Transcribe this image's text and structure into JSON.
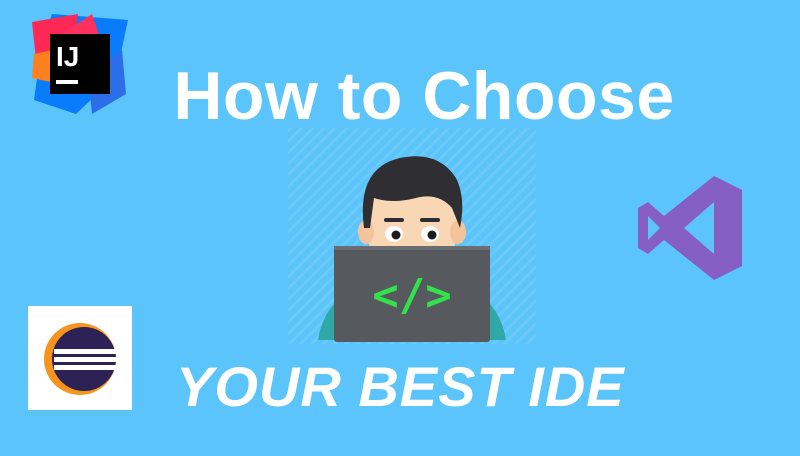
{
  "headline": "How to Choose",
  "subheadline": "YOUR BEST IDE",
  "logos": {
    "intellij_text": "IJ",
    "intellij_icon": "intellij-idea-logo-icon",
    "visual_studio_icon": "visual-studio-logo-icon",
    "eclipse_icon": "eclipse-logo-icon"
  },
  "illustration": {
    "icon": "developer-at-laptop-icon",
    "screen_glyph": "</>"
  },
  "colors": {
    "background": "#5bc4fb",
    "text": "#ffffff",
    "visual_studio_purple": "#865fc5",
    "eclipse_navy": "#2c2255",
    "eclipse_orange": "#f7941e",
    "laptop": "#565a5e",
    "code_green": "#33e14a"
  }
}
